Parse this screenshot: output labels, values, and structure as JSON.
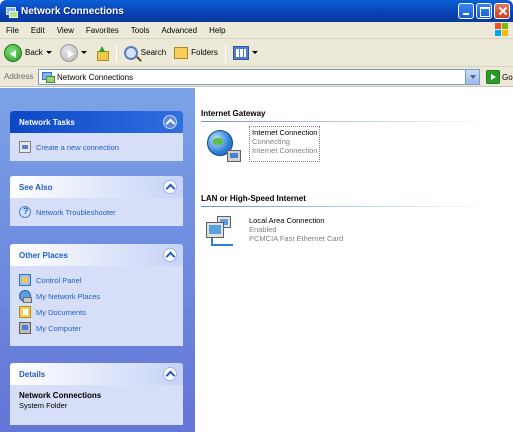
{
  "window": {
    "title": "Network Connections"
  },
  "menu": [
    "File",
    "Edit",
    "View",
    "Favorites",
    "Tools",
    "Advanced",
    "Help"
  ],
  "toolbar": {
    "back_label": "Back",
    "search_label": "Search",
    "folders_label": "Folders"
  },
  "address": {
    "label": "Address",
    "value": "Network Connections",
    "go_label": "Go"
  },
  "sidebar": {
    "network_tasks": {
      "title": "Network Tasks",
      "items": [
        {
          "label": "Create a new connection",
          "icon": "new-connection-icon"
        }
      ]
    },
    "see_also": {
      "title": "See Also",
      "items": [
        {
          "label": "Network Troubleshooter",
          "icon": "troubleshooter-icon"
        }
      ]
    },
    "other_places": {
      "title": "Other Places",
      "items": [
        {
          "label": "Control Panel",
          "icon": "control-panel-icon"
        },
        {
          "label": "My Network Places",
          "icon": "network-places-icon"
        },
        {
          "label": "My Documents",
          "icon": "my-documents-icon"
        },
        {
          "label": "My Computer",
          "icon": "my-computer-icon"
        }
      ]
    },
    "details": {
      "title": "Details",
      "name": "Network Connections",
      "type": "System Folder"
    }
  },
  "content": {
    "groups": [
      {
        "heading": "Internet Gateway",
        "connection": {
          "name": "Internet Connection",
          "status": "Connecting",
          "device": "Internet Connection"
        }
      },
      {
        "heading": "LAN or High-Speed Internet",
        "connection": {
          "name": "Local Area Connection",
          "status": "Enabled",
          "device": "PCMCIA Fast Ethernet Card"
        }
      }
    ]
  },
  "colors": {
    "titlebar": "#0841b5",
    "sidebar_bg": "#7ba2e7",
    "link": "#215dc6"
  }
}
